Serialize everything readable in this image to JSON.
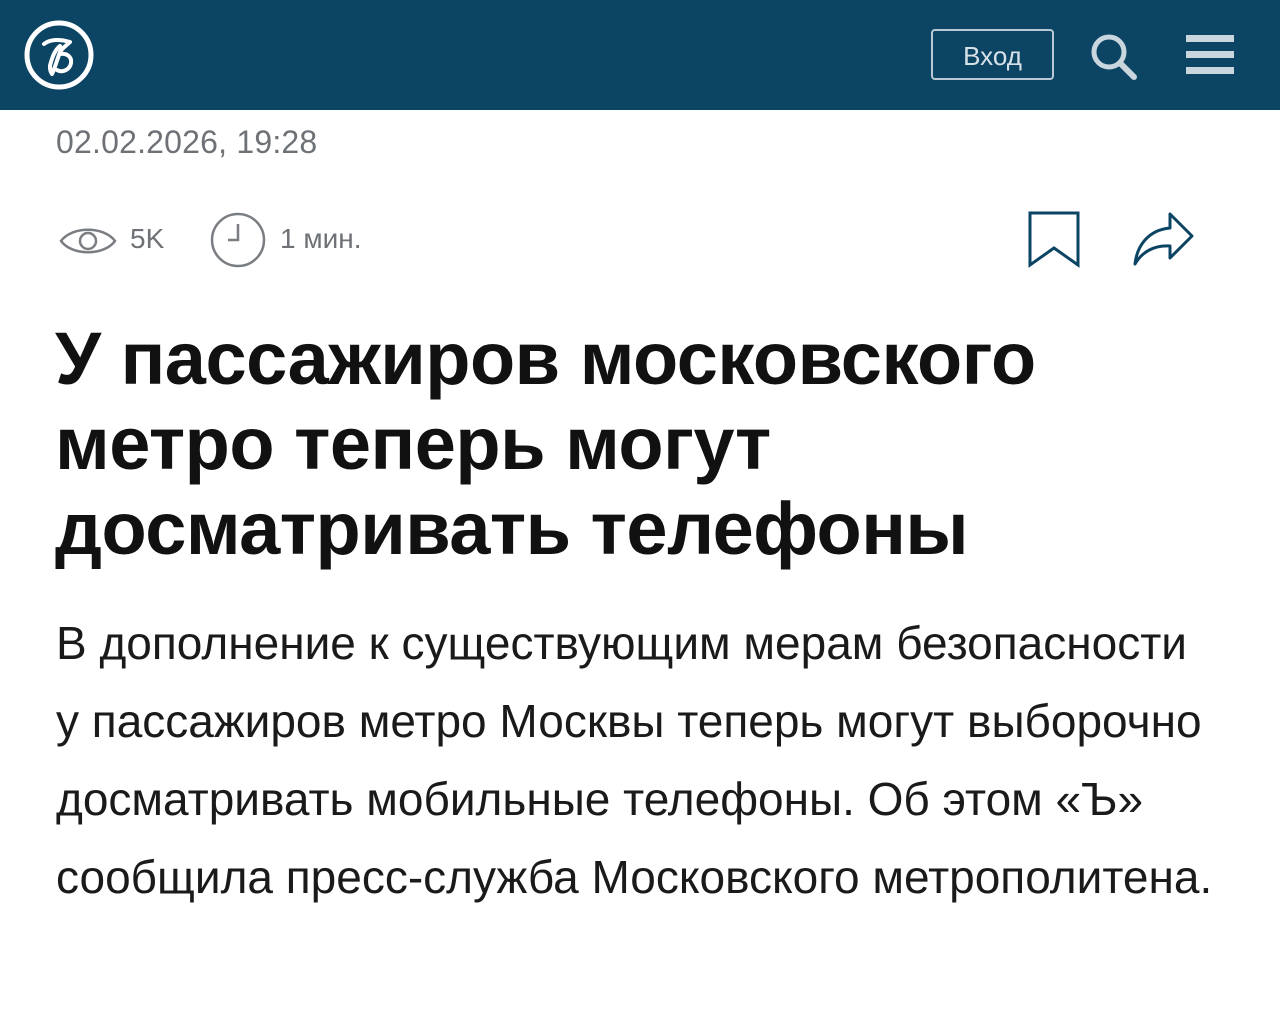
{
  "header": {
    "logo_letter": "Ъ",
    "login_label": "Вход",
    "search_icon": "search-icon",
    "menu_icon": "hamburger-menu-icon",
    "bg_color": "#0c4464"
  },
  "article": {
    "date": "02.02.2026, 19:28",
    "views": "5K",
    "read_time": "1 мин.",
    "title": "У пассажиров московского метро теперь могут досматривать телефоны",
    "lead": "В дополнение к существующим мерам безопасности у пассажиров метро Москвы теперь могут выборочно досматривать мобильные телефоны. Об этом «Ъ» сообщила пресс-служба Московского метрополитена."
  }
}
